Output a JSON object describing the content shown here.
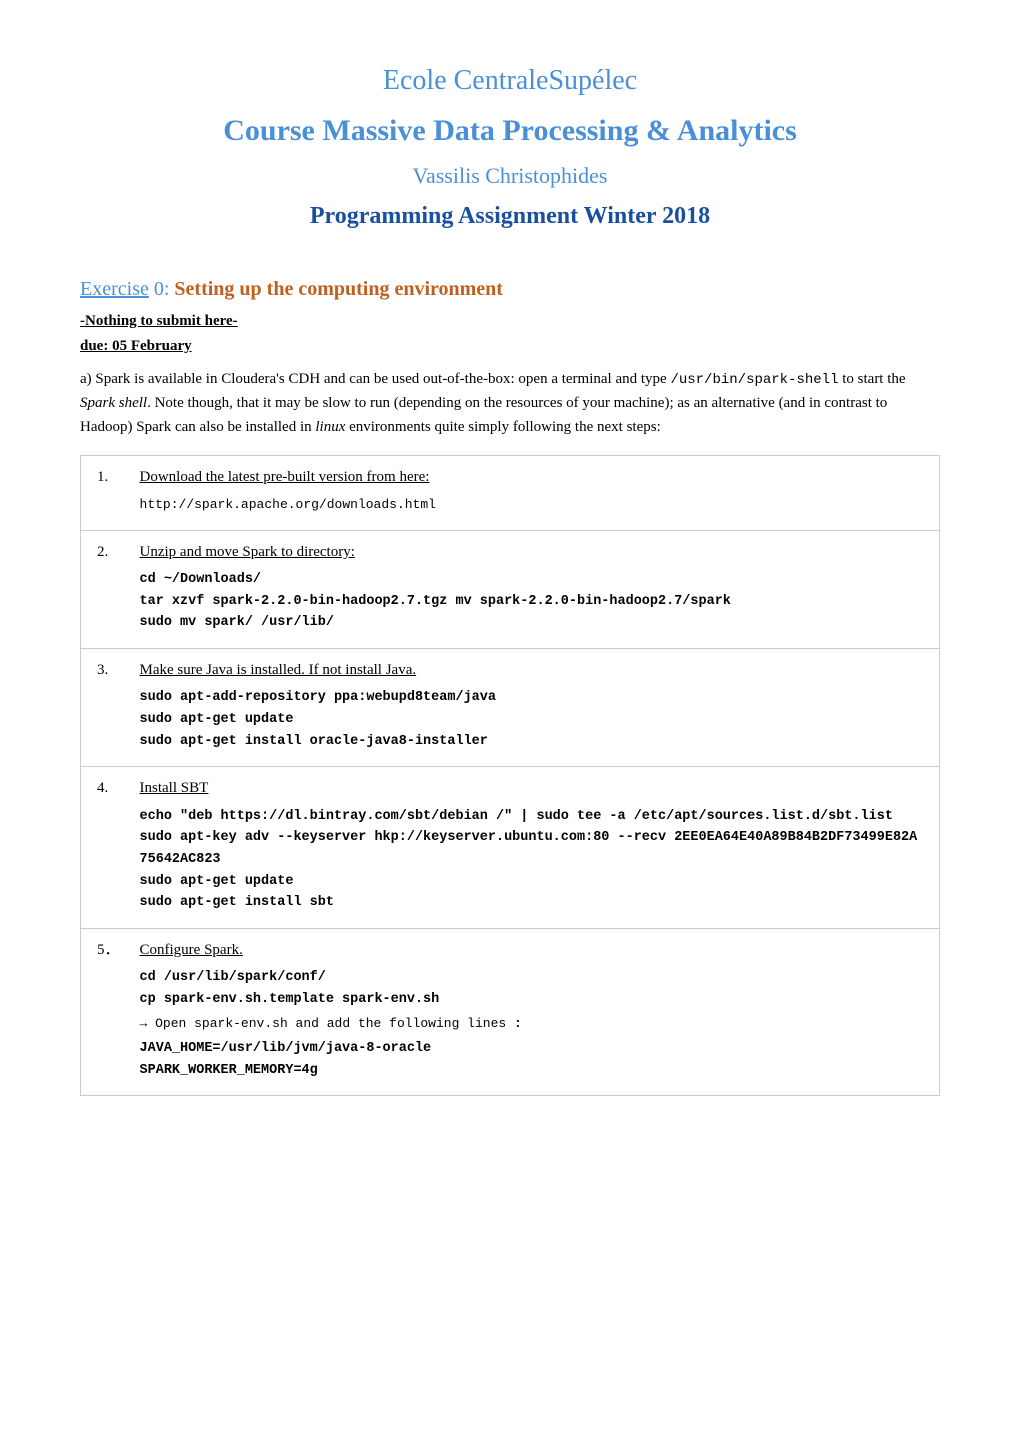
{
  "header": {
    "school": "Ecole CentraleSupélec",
    "course_prefix": "Course ",
    "course_bold": "Massive Data Processing & Analytics",
    "author": "Vassilis Christophides",
    "assignment": "Programming Assignment Winter 2018"
  },
  "exercise": {
    "label": "Exercise",
    "number": "0",
    "title": "Setting up the computing environment",
    "nothing_submit": "-Nothing to submit here-",
    "due": "due: 05 February",
    "intro": "a) Spark is available in Cloudera's CDH and can be used out-of-the-box: open a terminal and type ",
    "inline_code": "/usr/bin/spark-shell",
    "intro2": " to start the ",
    "italic_text": "Spark shell",
    "intro3": ". Note though, that it may be slow to run (depending on the resources of your machine); as an alternative (and in contrast to Hadoop) Spark can also be installed in ",
    "italic2": "linux",
    "intro4": " environments quite simply following the next steps:"
  },
  "steps": [
    {
      "num": "1.",
      "label": "Download the latest pre-built version from here:",
      "label_link": true,
      "code": "http://spark.apache.org/downloads.html",
      "code_bold": false
    },
    {
      "num": "2.",
      "label": "Unzip and move Spark to directory:",
      "label_link": true,
      "code": "cd ~/Downloads/\ntar xzvf spark-2.2.0-bin-hadoop2.7.tgz mv spark-2.2.0-bin-hadoop2.7/spark\nsudo mv spark/ /usr/lib/",
      "code_bold": true
    },
    {
      "num": "3.",
      "label": "Make sure Java is installed. If not install Java.",
      "label_link": true,
      "code": "sudo apt-add-repository ppa:webupd8team/java\nsudo apt-get update\nsudo apt-get install oracle-java8-installer",
      "code_bold": true
    },
    {
      "num": "4.",
      "label": "Install SBT",
      "label_link": true,
      "code": "echo \"deb https://dl.bintray.com/sbt/debian /\" | sudo tee -a /etc/apt/sources.list.d/sbt.list\nsudo apt-key adv --keyserver hkp://keyserver.ubuntu.com:80 --recv 2EE0EA64E40A89B84B2DF73499E82A75642AC823\nsudo apt-get update\nsudo apt-get install sbt",
      "code_bold": true
    },
    {
      "num": "5.",
      "label": "Configure Spark.",
      "label_link": true,
      "code_bold_lines": "cd /usr/lib/spark/conf/\ncp spark-env.sh.template spark-env.sh",
      "arrow_line": "→ Open spark-env.sh and add the following lines :",
      "code_bold_lines2": "JAVA_HOME=/usr/lib/jvm/java-8-oracle\nSPARK_WORKER_MEMORY=4g"
    }
  ]
}
